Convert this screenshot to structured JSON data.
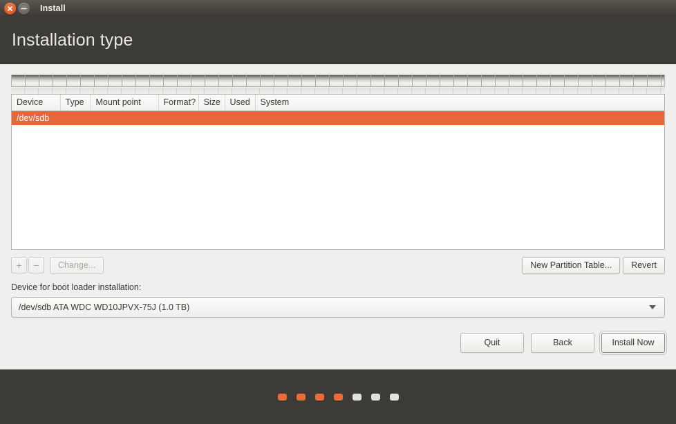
{
  "window": {
    "title": "Install",
    "close_icon": "close-icon",
    "minimize_icon": "minimize-icon"
  },
  "header": {
    "page_title": "Installation type"
  },
  "partition_table": {
    "columns": [
      "Device",
      "Type",
      "Mount point",
      "Format?",
      "Size",
      "Used",
      "System"
    ],
    "rows": [
      {
        "selected": true,
        "cells": [
          "/dev/sdb",
          "",
          "",
          "",
          "",
          "",
          ""
        ]
      }
    ],
    "selected_row_color": "#e8663c"
  },
  "toolbar": {
    "add_label": "+",
    "remove_label": "−",
    "change_label": "Change...",
    "add_enabled": false,
    "remove_enabled": false,
    "change_enabled": false,
    "new_partition_table_label": "New Partition Table...",
    "revert_label": "Revert"
  },
  "bootloader": {
    "label": "Device for boot loader installation:",
    "selected_value": "/dev/sdb  ATA WDC WD10JPVX-75J (1.0 TB)",
    "dropdown_icon": "chevron-down-icon"
  },
  "actions": {
    "quit_label": "Quit",
    "back_label": "Back",
    "install_label": "Install Now"
  },
  "progress": {
    "total_steps": 7,
    "completed_steps": 4,
    "active_color": "#ec6a35",
    "inactive_color": "#e4e2de"
  }
}
